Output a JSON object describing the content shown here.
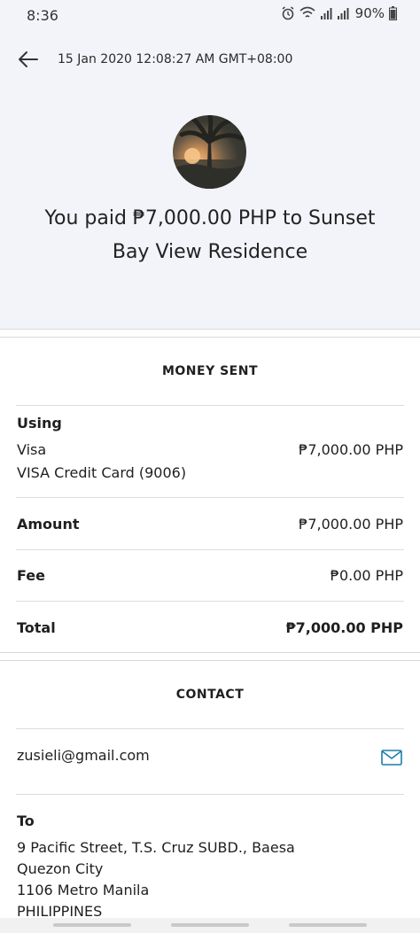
{
  "status_bar": {
    "time": "8:36",
    "battery": "90%",
    "icons": [
      "alarm-icon",
      "wifi-icon",
      "signal-icon",
      "signal-icon",
      "battery-icon"
    ]
  },
  "header": {
    "back_icon": "back-arrow-icon",
    "date": "15 Jan 2020 12:08:27 AM GMT+08:00",
    "headline_line1": "You paid ₱7,000.00 PHP to Sunset",
    "headline_line2": "Bay View Residence"
  },
  "money_sent": {
    "title": "MONEY SENT",
    "using_label": "Using",
    "card_brand": "Visa",
    "card_detail": "VISA Credit Card (9006)",
    "card_amount": "₱7,000.00 PHP",
    "amount_label": "Amount",
    "amount_value": "₱7,000.00 PHP",
    "fee_label": "Fee",
    "fee_value": "₱0.00 PHP",
    "total_label": "Total",
    "total_value": "₱7,000.00 PHP"
  },
  "contact": {
    "title": "CONTACT",
    "email": "zusieli@gmail.com",
    "email_icon": "mail-icon",
    "to_label": "To",
    "address_line1": "9 Pacific Street, T.S. Cruz SUBD., Baesa",
    "address_line2": "Quezon City",
    "address_line3": "1106 Metro Manila",
    "address_line4": "PHILIPPINES"
  },
  "colors": {
    "header_bg": "#f3f4fa",
    "accent": "#1a7fa8",
    "divider": "#dcdcdc"
  }
}
